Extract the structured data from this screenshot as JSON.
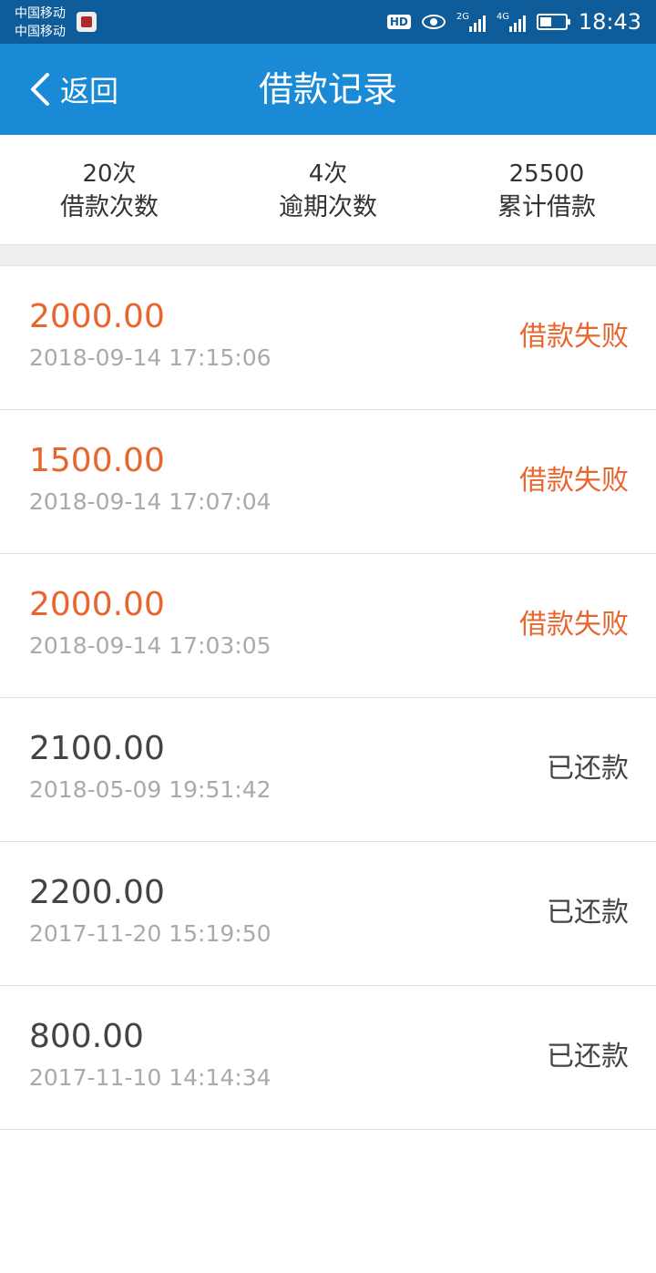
{
  "status_bar": {
    "carrier_1": "中国移动",
    "carrier_2": "中国移动",
    "hd": "HD",
    "net1": "2G",
    "net2": "4G",
    "time": "18:43"
  },
  "nav": {
    "back_label": "返回",
    "title": "借款记录"
  },
  "stats": [
    {
      "value": "20次",
      "label": "借款次数"
    },
    {
      "value": "4次",
      "label": "逾期次数"
    },
    {
      "value": "25500",
      "label": "累计借款"
    }
  ],
  "records": [
    {
      "amount": "2000.00",
      "time": "2018-09-14 17:15:06",
      "status": "借款失败",
      "state": "fail"
    },
    {
      "amount": "1500.00",
      "time": "2018-09-14 17:07:04",
      "status": "借款失败",
      "state": "fail"
    },
    {
      "amount": "2000.00",
      "time": "2018-09-14 17:03:05",
      "status": "借款失败",
      "state": "fail"
    },
    {
      "amount": "2100.00",
      "time": "2018-05-09 19:51:42",
      "status": "已还款",
      "state": "repaid"
    },
    {
      "amount": "2200.00",
      "time": "2017-11-20 15:19:50",
      "status": "已还款",
      "state": "repaid"
    },
    {
      "amount": "800.00",
      "time": "2017-11-10 14:14:34",
      "status": "已还款",
      "state": "repaid"
    }
  ],
  "colors": {
    "navbar": "#1a8ad6",
    "status_bar": "#0f5c9b",
    "fail": "#e8662e",
    "normal": "#444444",
    "timestamp": "#aaaaaa"
  }
}
